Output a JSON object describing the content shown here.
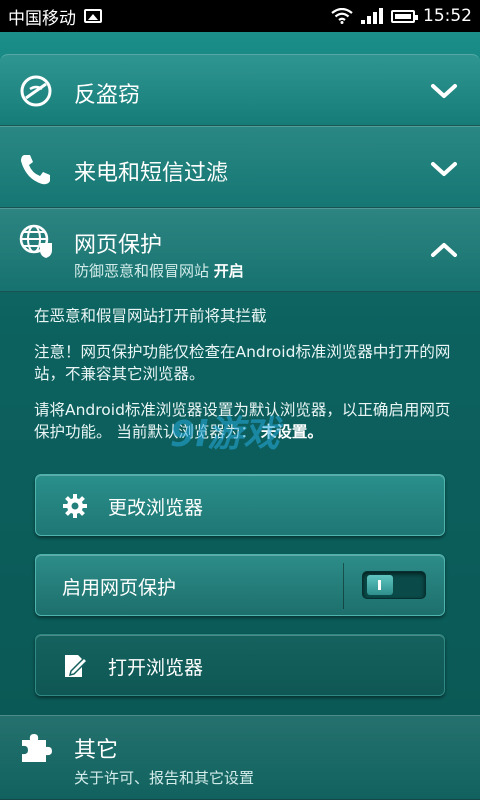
{
  "status_bar": {
    "carrier": "中国移动",
    "time": "15:52"
  },
  "sections": {
    "anti_theft": {
      "title": "反盗窃"
    },
    "call_sms_filter": {
      "title": "来电和短信过滤"
    },
    "web_protection": {
      "title": "网页保护",
      "subtitle": "防御恶意和假冒网站",
      "state": "开启",
      "para1": "在恶意和假冒网站打开前将其拦截",
      "para2": "注意！网页保护功能仅检查在Android标准浏览器中打开的网站，不兼容其它浏览器。",
      "para3_main": "请将Android标准浏览器设置为默认浏览器，以正确启用网页保护功能。 当前默认浏览器为：",
      "para3_value": "未设置",
      "para3_end": "。",
      "change_browser_label": "更改浏览器",
      "enable_label": "启用网页保护",
      "enable_state": "on",
      "open_browser_label": "打开浏览器"
    },
    "other": {
      "title": "其它",
      "subtitle": "关于许可、报告和其它设置"
    }
  },
  "watermark": "9l游戏",
  "colors": {
    "background": "#0d5c59",
    "accent": "#1b8f8a"
  },
  "icons": [
    "picture-icon",
    "wifi-icon",
    "signal-icon",
    "battery-icon",
    "no-theft-icon",
    "phone-icon",
    "globe-shield-icon",
    "gear-icon",
    "edit-icon",
    "puzzle-icon",
    "chevron-down-icon",
    "chevron-up-icon"
  ]
}
